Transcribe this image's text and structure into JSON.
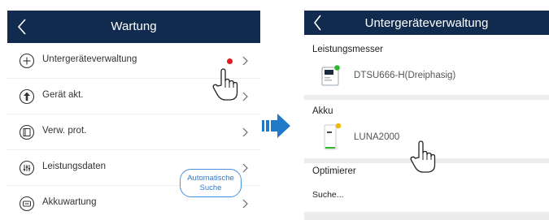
{
  "left": {
    "title": "Wartung",
    "items": [
      {
        "label": "Untergeräteverwaltung",
        "icon": "add-circle-icon",
        "has_dot": true
      },
      {
        "label": "Gerät akt.",
        "icon": "upgrade-icon",
        "has_dot": false
      },
      {
        "label": "Verw. prot.",
        "icon": "log-icon",
        "has_dot": false
      },
      {
        "label": "Leistungsdaten",
        "icon": "performance-data-icon",
        "has_dot": false
      },
      {
        "label": "Akkuwartung",
        "icon": "battery-maintenance-icon",
        "has_dot": false
      }
    ]
  },
  "right": {
    "title": "Untergeräteverwaltung",
    "sections": [
      {
        "title": "Leistungsmesser",
        "device": "DTSU666-H(Dreiphasig)"
      },
      {
        "title": "Akku",
        "device": "LUNA2000"
      },
      {
        "title": "Optimierer",
        "status": "Suche...",
        "button_line1": "Automatische",
        "button_line2": "Suche"
      }
    ]
  },
  "colors": {
    "header_bg": "#112b4f",
    "notification_dot": "#e01b24",
    "arrow": "#1f78c8",
    "button_accent": "#3478c6",
    "online_green": "#2eb82e",
    "battery_yellow": "#f5b400"
  }
}
